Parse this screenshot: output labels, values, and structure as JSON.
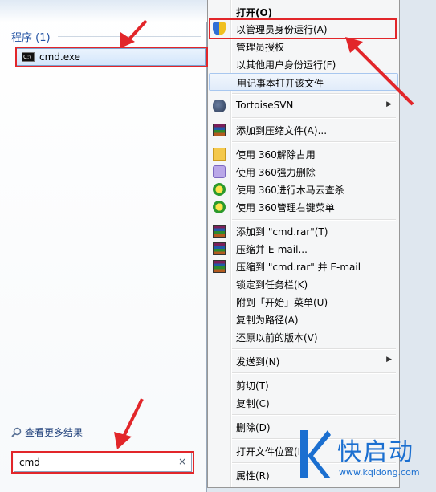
{
  "start_menu": {
    "section_title": "程序 (1)",
    "result_item": "cmd.exe",
    "cmd_icon_text": "C:\\",
    "more_results": "查看更多结果",
    "search_value": "cmd",
    "clear_glyph": "×"
  },
  "context_menu": {
    "items": [
      {
        "label": "打开(O)",
        "icon": ""
      },
      {
        "label": "以管理员身份运行(A)",
        "icon": "uac-shield-icon"
      },
      {
        "label": "管理员授权",
        "icon": ""
      },
      {
        "label": "以其他用户身份运行(F)",
        "icon": ""
      },
      {
        "label": "用记事本打开该文件",
        "icon": ""
      },
      {
        "label": "TortoiseSVN",
        "icon": "tortoisesvn-icon"
      },
      {
        "label": "添加到压缩文件(A)...",
        "icon": "winrar-icon"
      },
      {
        "label": "使用 360解除占用",
        "icon": "folder-unlock-icon"
      },
      {
        "label": "使用 360强力删除",
        "icon": "eraser-icon"
      },
      {
        "label": "使用 360进行木马云查杀",
        "icon": "360-icon"
      },
      {
        "label": "使用 360管理右键菜单",
        "icon": "360-icon"
      },
      {
        "label": "添加到 \"cmd.rar\"(T)",
        "icon": "winrar-icon"
      },
      {
        "label": "压缩并 E-mail...",
        "icon": "winrar-icon"
      },
      {
        "label": "压缩到 \"cmd.rar\" 并 E-mail",
        "icon": "winrar-icon"
      },
      {
        "label": "锁定到任务栏(K)",
        "icon": ""
      },
      {
        "label": "附到「开始」菜单(U)",
        "icon": ""
      },
      {
        "label": "复制为路径(A)",
        "icon": ""
      },
      {
        "label": "还原以前的版本(V)",
        "icon": ""
      },
      {
        "label": "发送到(N)",
        "icon": ""
      },
      {
        "label": "剪切(T)",
        "icon": ""
      },
      {
        "label": "复制(C)",
        "icon": ""
      },
      {
        "label": "删除(D)",
        "icon": ""
      },
      {
        "label": "打开文件位置(I)",
        "icon": ""
      },
      {
        "label": "属性(R)",
        "icon": ""
      }
    ],
    "submenu_arrow": "▶"
  },
  "watermark": {
    "title": "快启动",
    "url": "www.kqidong.com"
  },
  "colors": {
    "annotation_red": "#e2262a",
    "watermark_blue": "#1b6fd0"
  }
}
